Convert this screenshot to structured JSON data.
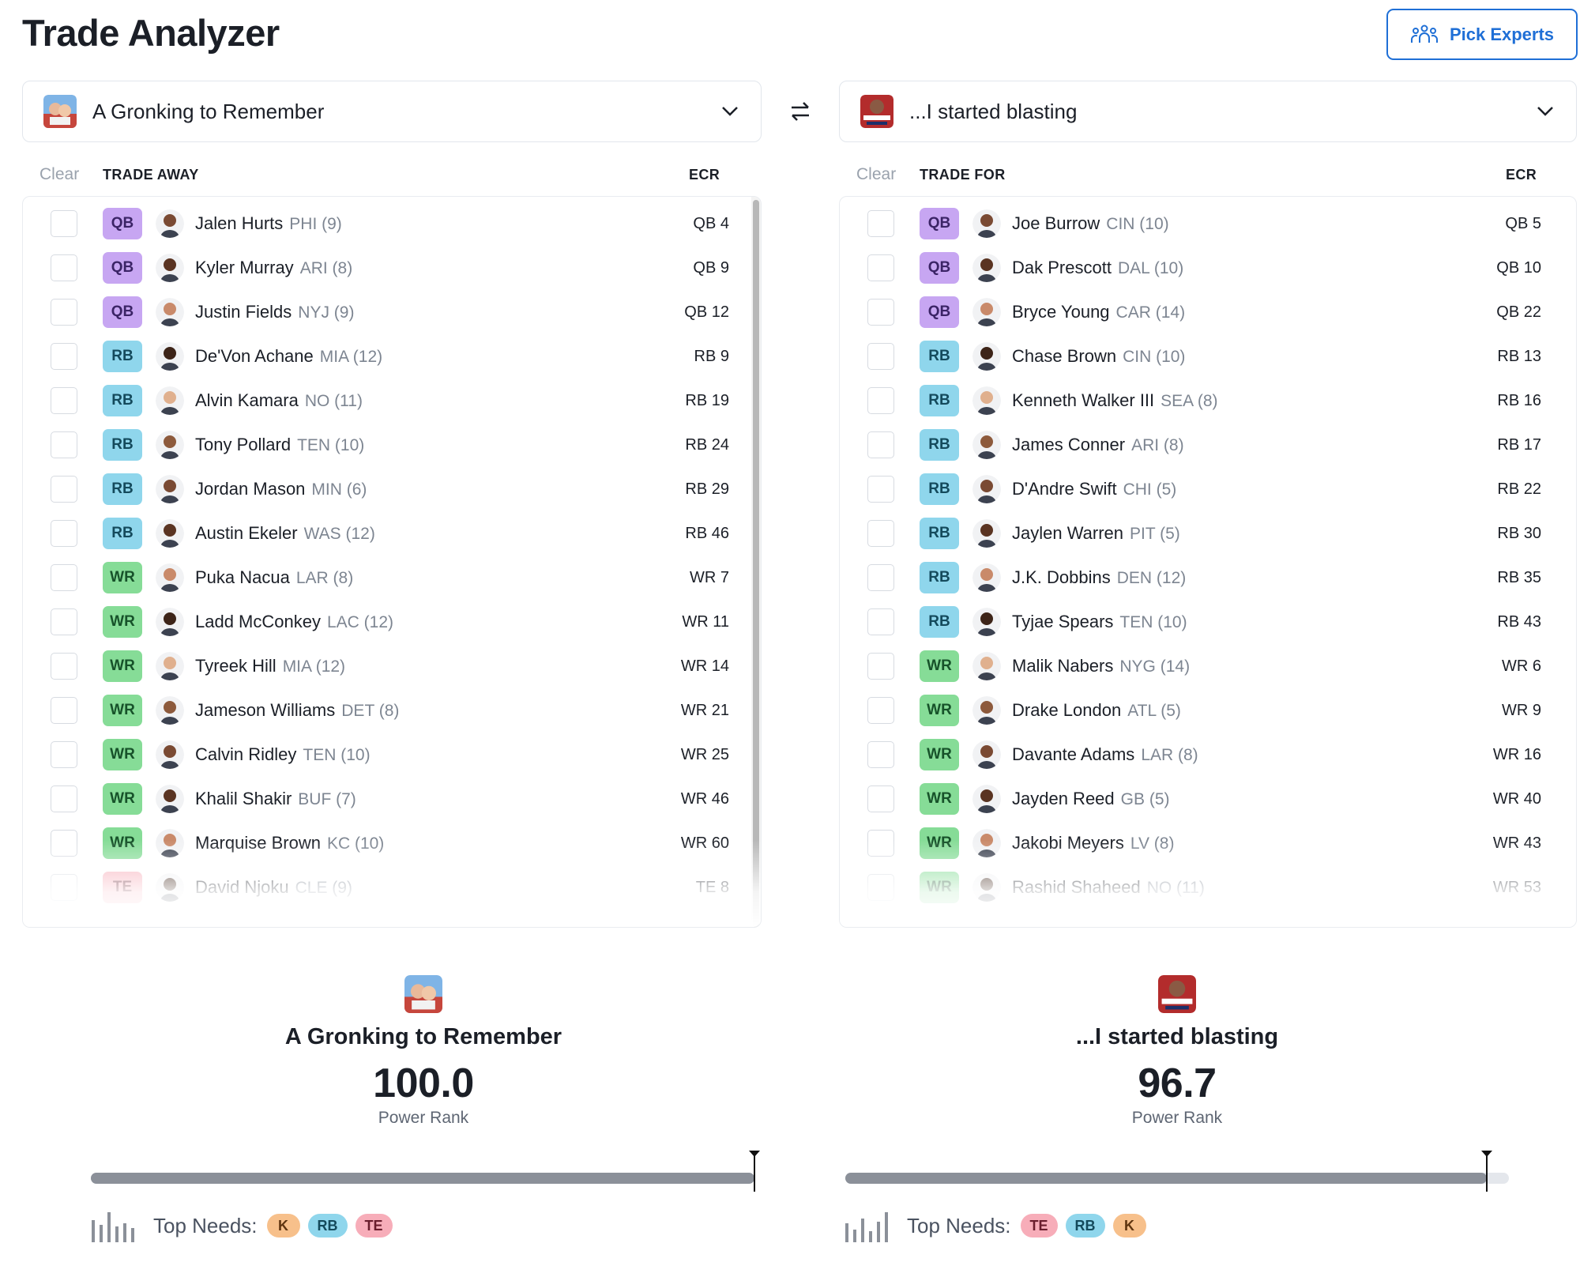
{
  "title": "Trade Analyzer",
  "pick_experts_label": "Pick Experts",
  "team_a": {
    "name": "A Gronking to Remember"
  },
  "team_b": {
    "name": "...I started blasting"
  },
  "trade_away": {
    "clear_label": "Clear",
    "header": "TRADE AWAY",
    "ecr_header": "ECR",
    "players": [
      {
        "pos": "QB",
        "name": "Jalen Hurts",
        "meta": "PHI (9)",
        "ecr": "QB 4"
      },
      {
        "pos": "QB",
        "name": "Kyler Murray",
        "meta": "ARI (8)",
        "ecr": "QB 9"
      },
      {
        "pos": "QB",
        "name": "Justin Fields",
        "meta": "NYJ (9)",
        "ecr": "QB 12"
      },
      {
        "pos": "RB",
        "name": "De'Von Achane",
        "meta": "MIA (12)",
        "ecr": "RB 9"
      },
      {
        "pos": "RB",
        "name": "Alvin Kamara",
        "meta": "NO (11)",
        "ecr": "RB 19"
      },
      {
        "pos": "RB",
        "name": "Tony Pollard",
        "meta": "TEN (10)",
        "ecr": "RB 24"
      },
      {
        "pos": "RB",
        "name": "Jordan Mason",
        "meta": "MIN (6)",
        "ecr": "RB 29"
      },
      {
        "pos": "RB",
        "name": "Austin Ekeler",
        "meta": "WAS (12)",
        "ecr": "RB 46"
      },
      {
        "pos": "WR",
        "name": "Puka Nacua",
        "meta": "LAR (8)",
        "ecr": "WR 7"
      },
      {
        "pos": "WR",
        "name": "Ladd McConkey",
        "meta": "LAC (12)",
        "ecr": "WR 11"
      },
      {
        "pos": "WR",
        "name": "Tyreek Hill",
        "meta": "MIA (12)",
        "ecr": "WR 14"
      },
      {
        "pos": "WR",
        "name": "Jameson Williams",
        "meta": "DET (8)",
        "ecr": "WR 21"
      },
      {
        "pos": "WR",
        "name": "Calvin Ridley",
        "meta": "TEN (10)",
        "ecr": "WR 25"
      },
      {
        "pos": "WR",
        "name": "Khalil Shakir",
        "meta": "BUF (7)",
        "ecr": "WR 46"
      },
      {
        "pos": "WR",
        "name": "Marquise Brown",
        "meta": "KC (10)",
        "ecr": "WR 60"
      },
      {
        "pos": "TE",
        "name": "David Njoku",
        "meta": "CLE (9)",
        "ecr": "TE 8"
      }
    ]
  },
  "trade_for": {
    "clear_label": "Clear",
    "header": "TRADE FOR",
    "ecr_header": "ECR",
    "players": [
      {
        "pos": "QB",
        "name": "Joe Burrow",
        "meta": "CIN (10)",
        "ecr": "QB 5"
      },
      {
        "pos": "QB",
        "name": "Dak Prescott",
        "meta": "DAL (10)",
        "ecr": "QB 10"
      },
      {
        "pos": "QB",
        "name": "Bryce Young",
        "meta": "CAR (14)",
        "ecr": "QB 22"
      },
      {
        "pos": "RB",
        "name": "Chase Brown",
        "meta": "CIN (10)",
        "ecr": "RB 13"
      },
      {
        "pos": "RB",
        "name": "Kenneth Walker III",
        "meta": "SEA (8)",
        "ecr": "RB 16"
      },
      {
        "pos": "RB",
        "name": "James Conner",
        "meta": "ARI (8)",
        "ecr": "RB 17"
      },
      {
        "pos": "RB",
        "name": "D'Andre Swift",
        "meta": "CHI (5)",
        "ecr": "RB 22"
      },
      {
        "pos": "RB",
        "name": "Jaylen Warren",
        "meta": "PIT (5)",
        "ecr": "RB 30"
      },
      {
        "pos": "RB",
        "name": "J.K. Dobbins",
        "meta": "DEN (12)",
        "ecr": "RB 35"
      },
      {
        "pos": "RB",
        "name": "Tyjae Spears",
        "meta": "TEN (10)",
        "ecr": "RB 43"
      },
      {
        "pos": "WR",
        "name": "Malik Nabers",
        "meta": "NYG (14)",
        "ecr": "WR 6"
      },
      {
        "pos": "WR",
        "name": "Drake London",
        "meta": "ATL (5)",
        "ecr": "WR 9"
      },
      {
        "pos": "WR",
        "name": "Davante Adams",
        "meta": "LAR (8)",
        "ecr": "WR 16"
      },
      {
        "pos": "WR",
        "name": "Jayden Reed",
        "meta": "GB (5)",
        "ecr": "WR 40"
      },
      {
        "pos": "WR",
        "name": "Jakobi Meyers",
        "meta": "LV (8)",
        "ecr": "WR 43"
      },
      {
        "pos": "WR",
        "name": "Rashid Shaheed",
        "meta": "NO (11)",
        "ecr": "WR 53"
      }
    ]
  },
  "summary_a": {
    "name": "A Gronking to Remember",
    "score": "100.0",
    "label": "Power Rank",
    "rank_fraction": 1.0,
    "needs_label": "Top Needs:",
    "needs": [
      "K",
      "RB",
      "TE"
    ]
  },
  "summary_b": {
    "name": "...I started blasting",
    "score": "96.7",
    "label": "Power Rank",
    "rank_fraction": 0.967,
    "needs_label": "Top Needs:",
    "needs": [
      "TE",
      "RB",
      "K"
    ]
  },
  "colors": {
    "accent": "#1f6fd6",
    "qb": "#c7a6f2",
    "rb": "#8fd6ec",
    "wr": "#86dc97",
    "te": "#f7adb9",
    "k": "#f7c08b"
  }
}
